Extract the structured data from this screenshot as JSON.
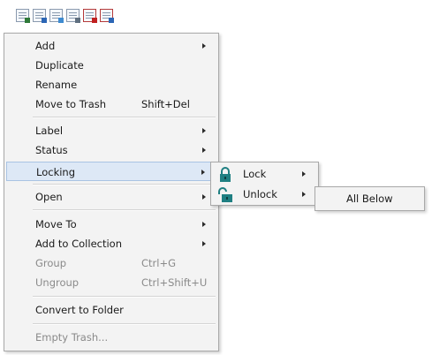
{
  "toolbar": {
    "icons": [
      "document-icon",
      "document-blue-icon",
      "document-split-icon",
      "document-lines-icon",
      "document-red-icon",
      "document-red-blue-icon"
    ]
  },
  "main_menu": {
    "add": "Add",
    "duplicate": "Duplicate",
    "rename": "Rename",
    "move_to_trash": "Move to Trash",
    "move_to_trash_shortcut": "Shift+Del",
    "label": "Label",
    "status": "Status",
    "locking": "Locking",
    "open": "Open",
    "move_to": "Move To",
    "add_to_collection": "Add to Collection",
    "group": "Group",
    "group_shortcut": "Ctrl+G",
    "ungroup": "Ungroup",
    "ungroup_shortcut": "Ctrl+Shift+U",
    "convert_to_folder": "Convert to Folder",
    "empty_trash": "Empty Trash..."
  },
  "locking_menu": {
    "lock": "Lock",
    "unlock": "Unlock"
  },
  "unlock_menu": {
    "all_below": "All Below"
  },
  "colors": {
    "menu_bg": "#f3f3f3",
    "highlight": "#dde8f6",
    "lock_icon": "#1f7f82"
  }
}
